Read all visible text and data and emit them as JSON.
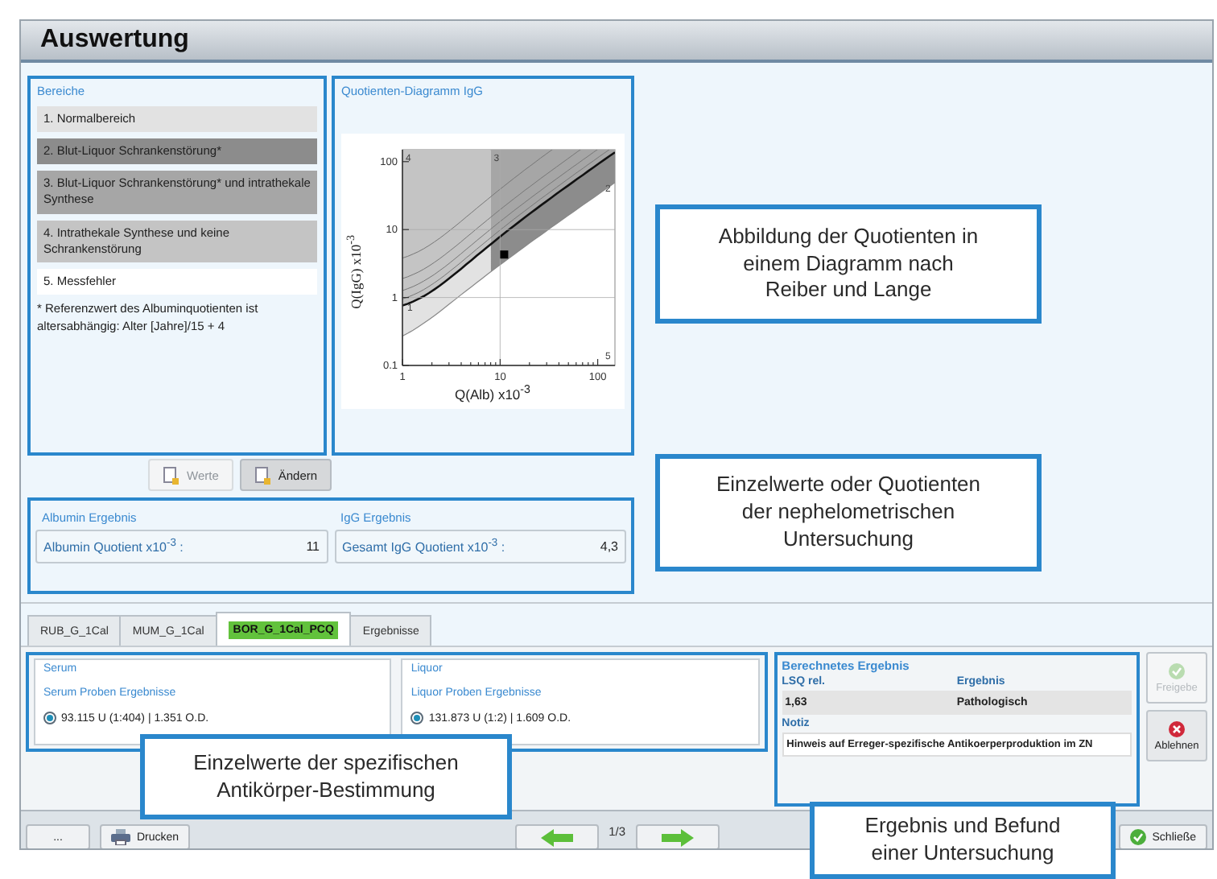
{
  "window": {
    "title": "Auswertung"
  },
  "bereiche": {
    "title": "Bereiche",
    "items": [
      {
        "label": "1. Normalbereich",
        "color": "#e2e2e2"
      },
      {
        "label": "2. Blut-Liquor Schrankenstörung*",
        "color": "#8c8c8c"
      },
      {
        "label": "3. Blut-Liquor Schrankenstörung* und intrathekale Synthese",
        "color": "#a6a6a6"
      },
      {
        "label": "4. Intrathekale Synthese und keine Schrankenstörung",
        "color": "#c4c4c4"
      },
      {
        "label": "5. Messfehler",
        "color": "#ffffff"
      }
    ],
    "footnote": "* Referenzwert des Albuminquotienten ist altersabhängig: Alter [Jahre]/15 + 4"
  },
  "diagram": {
    "title": "Quotienten-Diagramm IgG",
    "xlabel": "Q(Alb) x10$^{-3}$",
    "ylabel": "Q(IgG) x10$^{-3}$",
    "x_tick_labels": [
      "1",
      "10",
      "100"
    ],
    "y_tick_labels": [
      "100",
      "10",
      "1",
      "0.1"
    ],
    "region_labels": [
      "4",
      "3",
      "2",
      "1",
      "5"
    ]
  },
  "buttons": [
    {
      "label": "Werte",
      "disabled": true
    },
    {
      "label": "Ändern",
      "disabled": false
    }
  ],
  "results": [
    {
      "title": "Albumin Ergebnis",
      "label": "Albumin Quotient x10$^{-3}$ :",
      "value": "11"
    },
    {
      "title": "IgG Ergebnis",
      "label": "Gesamt IgG Quotient x10$^{-3}$ :",
      "value": "4,3"
    }
  ],
  "tabs": [
    {
      "label": "RUB_G_1Cal",
      "selected": false
    },
    {
      "label": "MUM_G_1Cal",
      "selected": false
    },
    {
      "label": "BOR_G_1Cal_PCQ",
      "selected": true
    },
    {
      "label": "Ergebnisse",
      "selected": false
    }
  ],
  "samples": [
    {
      "title": "Serum",
      "subtitle": "Serum Proben Ergebnisse",
      "options": [
        {
          "label": "93.115 U (1:404) | 1.351 O.D.",
          "selected": true
        }
      ]
    },
    {
      "title": "Liquor",
      "subtitle": "Liquor Proben Ergebnisse",
      "options": [
        {
          "label": "131.873 U (1:2) | 1.609 O.D.",
          "selected": true
        }
      ]
    }
  ],
  "calculated": {
    "title": "Berechnetes Ergebnis",
    "columns": [
      "LSQ rel.",
      "Ergebnis"
    ],
    "row": [
      "1,63",
      "Pathologisch"
    ],
    "note_label": "Notiz",
    "note": "Hinweis auf Erreger-spezifische Antikoerperproduktion im ZN"
  },
  "side_buttons": [
    {
      "label": "Freigebe",
      "kind": "approve",
      "disabled": true
    },
    {
      "label": "Ablehnen",
      "kind": "reject",
      "disabled": false
    }
  ],
  "footer": {
    "more": "...",
    "print": "Drucken",
    "page": "1/3",
    "close": "Schließe"
  },
  "callouts": [
    "Abbildung der Quotienten in einem Diagramm nach Reiber und Lange",
    "Einzelwerte oder Quotienten der nephelometrischen Untersuchung",
    "Einzelwerte der spezifischen Antikörper-Bestimmung",
    "Ergebnis und Befund einer Untersuchung"
  ]
}
